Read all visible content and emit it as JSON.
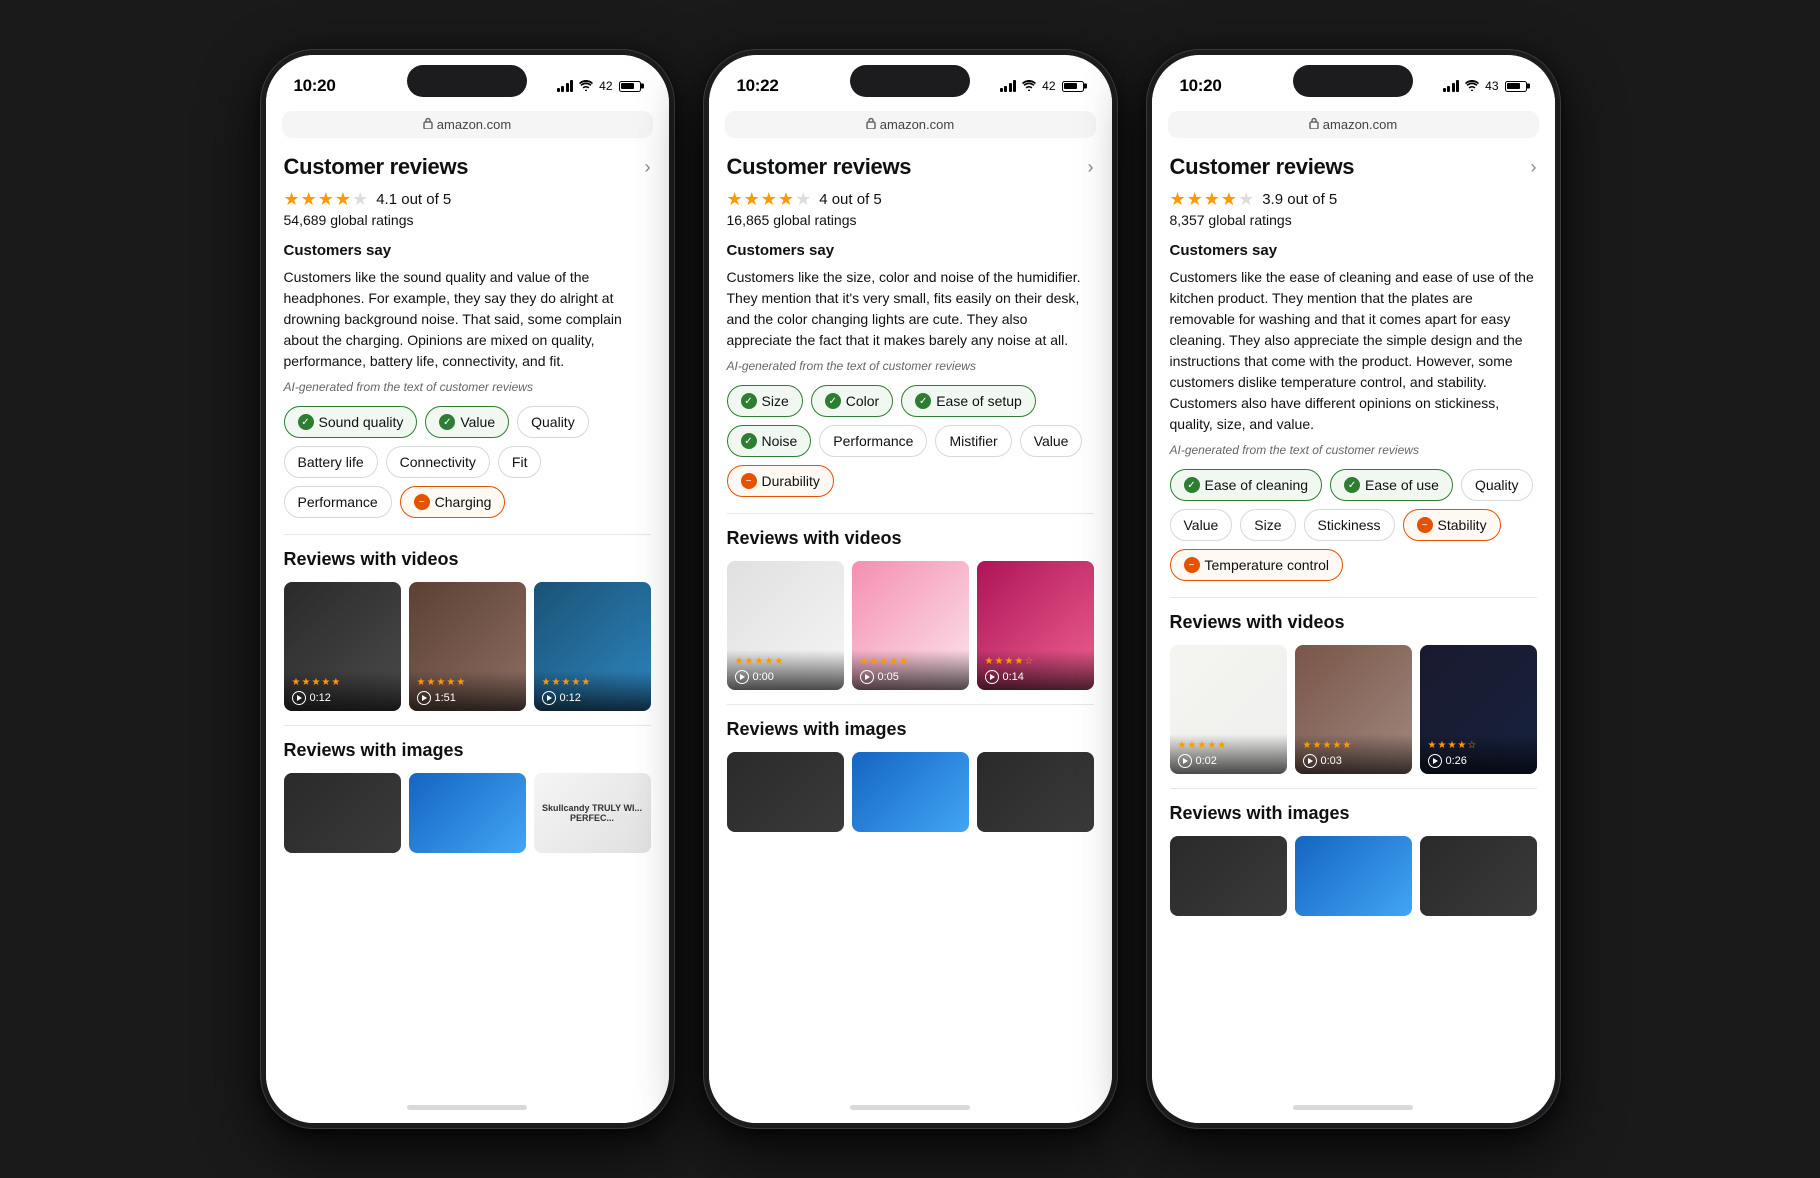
{
  "phones": [
    {
      "id": "phone-1",
      "status_time": "10:20",
      "battery_pct": "42",
      "url": "amazon.com",
      "reviews": {
        "title": "Customer reviews",
        "rating_value": "4.1 out of 5",
        "global_ratings": "54,689 global ratings",
        "customers_say_title": "Customers say",
        "customers_say_text": "Customers like the sound quality and value of the headphones. For example, they say they do alright at drowning background noise. That said, some complain about the charging. Opinions are mixed on quality, performance, battery life, connectivity, and fit.",
        "ai_note": "AI-generated from the text of customer reviews",
        "stars": [
          {
            "type": "full"
          },
          {
            "type": "full"
          },
          {
            "type": "full"
          },
          {
            "type": "half"
          },
          {
            "type": "empty"
          }
        ],
        "tags": [
          {
            "label": "Sound quality",
            "sentiment": "positive"
          },
          {
            "label": "Value",
            "sentiment": "positive"
          },
          {
            "label": "Quality",
            "sentiment": "neutral"
          },
          {
            "label": "Battery life",
            "sentiment": "neutral"
          },
          {
            "label": "Connectivity",
            "sentiment": "neutral"
          },
          {
            "label": "Fit",
            "sentiment": "neutral"
          },
          {
            "label": "Performance",
            "sentiment": "neutral"
          },
          {
            "label": "Charging",
            "sentiment": "negative"
          }
        ]
      },
      "reviews_videos_title": "Reviews with videos",
      "videos": [
        {
          "bg": "vbg-dark",
          "stars": 5,
          "duration": "0:12"
        },
        {
          "bg": "vbg-brown",
          "stars": 5,
          "duration": "1:51"
        },
        {
          "bg": "vbg-teal",
          "stars": 5,
          "duration": "0:12"
        }
      ],
      "reviews_images_title": "Reviews with images",
      "images": [
        {
          "bg": "img-thumb-dark"
        },
        {
          "bg": "img-thumb-blue"
        },
        {
          "bg": "img-thumb-text",
          "label": "Skullcandy\nTRULY WI...\nPERFEC..."
        }
      ]
    },
    {
      "id": "phone-2",
      "status_time": "10:22",
      "battery_pct": "42",
      "url": "amazon.com",
      "reviews": {
        "title": "Customer reviews",
        "rating_value": "4 out of 5",
        "global_ratings": "16,865 global ratings",
        "customers_say_title": "Customers say",
        "customers_say_text": "Customers like the size, color and noise of the humidifier. They mention that it's very small, fits easily on their desk, and the color changing lights are cute. They also appreciate the fact that it makes barely any noise at all.",
        "ai_note": "AI-generated from the text of customer reviews",
        "stars": [
          {
            "type": "full"
          },
          {
            "type": "full"
          },
          {
            "type": "full"
          },
          {
            "type": "full"
          },
          {
            "type": "empty"
          }
        ],
        "tags": [
          {
            "label": "Size",
            "sentiment": "positive"
          },
          {
            "label": "Color",
            "sentiment": "positive"
          },
          {
            "label": "Ease of setup",
            "sentiment": "positive"
          },
          {
            "label": "Noise",
            "sentiment": "positive"
          },
          {
            "label": "Performance",
            "sentiment": "neutral"
          },
          {
            "label": "Mistifier",
            "sentiment": "neutral"
          },
          {
            "label": "Value",
            "sentiment": "neutral"
          },
          {
            "label": "Durability",
            "sentiment": "negative"
          }
        ]
      },
      "reviews_videos_title": "Reviews with videos",
      "videos": [
        {
          "bg": "vbg-white-gray",
          "stars": 5,
          "duration": "0:00"
        },
        {
          "bg": "vbg-pink",
          "stars": 5,
          "duration": "0:05"
        },
        {
          "bg": "vbg-magenta",
          "stars": 4,
          "duration": "0:14"
        }
      ],
      "reviews_images_title": "Reviews with images",
      "images": [
        {
          "bg": "img-thumb-dark"
        },
        {
          "bg": "img-thumb-blue"
        },
        {
          "bg": "img-thumb-dark"
        }
      ]
    },
    {
      "id": "phone-3",
      "status_time": "10:20",
      "battery_pct": "43",
      "url": "amazon.com",
      "reviews": {
        "title": "Customer reviews",
        "rating_value": "3.9 out of 5",
        "global_ratings": "8,357 global ratings",
        "customers_say_title": "Customers say",
        "customers_say_text": "Customers like the ease of cleaning and ease of use of the kitchen product. They mention that the plates are removable for washing and that it comes apart for easy cleaning. They also appreciate the simple design and the instructions that come with the product. However, some customers dislike temperature control, and stability. Customers also have different opinions on stickiness, quality, size, and value.",
        "ai_note": "AI-generated from the text of customer reviews",
        "stars": [
          {
            "type": "full"
          },
          {
            "type": "full"
          },
          {
            "type": "full"
          },
          {
            "type": "half"
          },
          {
            "type": "empty"
          }
        ],
        "tags": [
          {
            "label": "Ease of cleaning",
            "sentiment": "positive"
          },
          {
            "label": "Ease of use",
            "sentiment": "positive"
          },
          {
            "label": "Quality",
            "sentiment": "neutral"
          },
          {
            "label": "Value",
            "sentiment": "neutral"
          },
          {
            "label": "Size",
            "sentiment": "neutral"
          },
          {
            "label": "Stickiness",
            "sentiment": "neutral"
          },
          {
            "label": "Stability",
            "sentiment": "negative"
          },
          {
            "label": "Temperature control",
            "sentiment": "negative"
          }
        ]
      },
      "reviews_videos_title": "Reviews with videos",
      "videos": [
        {
          "bg": "vbg-paper",
          "stars": 5,
          "duration": "0:02"
        },
        {
          "bg": "vbg-wood",
          "stars": 5,
          "duration": "0:03"
        },
        {
          "bg": "vbg-dark2",
          "stars": 4,
          "duration": "0:26"
        }
      ],
      "reviews_images_title": "Reviews with images",
      "images": [
        {
          "bg": "img-thumb-dark"
        },
        {
          "bg": "img-thumb-blue"
        },
        {
          "bg": "img-thumb-dark"
        }
      ]
    }
  ],
  "icons": {
    "checkmark": "✓",
    "minus": "−",
    "lock": "🔒",
    "chevron": "›",
    "wifi": "wifi"
  }
}
